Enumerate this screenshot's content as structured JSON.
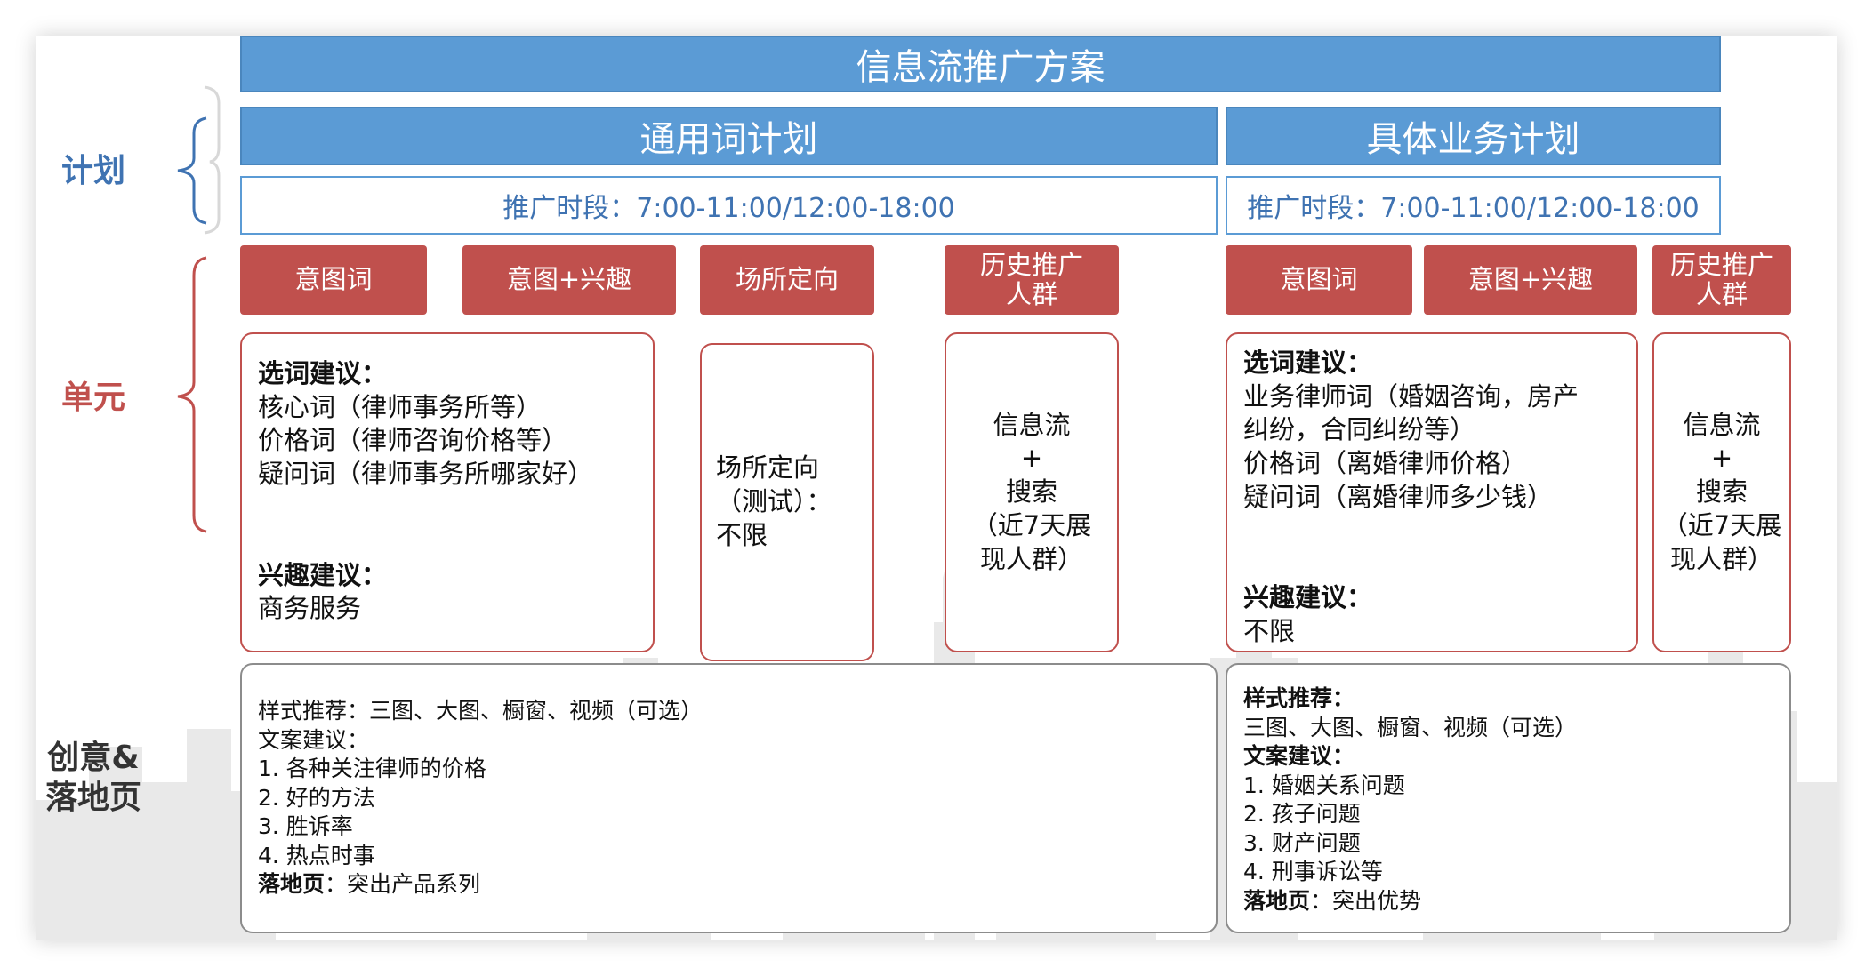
{
  "title": "信息流推广方案",
  "colors": {
    "blue": "#5b9bd5",
    "red": "#c0504d",
    "gray_border": "#8c8c8c"
  },
  "side_labels": {
    "plan": "计划",
    "unit": "单元",
    "creative_line1": "创意&",
    "creative_line2": "落地页"
  },
  "plans": [
    {
      "name": "通用词计划",
      "period": "推广时段：7:00-11:00/12:00-18:00",
      "units": [
        {
          "name": "意图词"
        },
        {
          "name": "意图+兴趣"
        },
        {
          "name": "场所定向"
        },
        {
          "name_line1": "历史推广",
          "name_line2": "人群"
        }
      ],
      "keyword_box": {
        "heading": "选词建议：",
        "lines": [
          "核心词（律师事务所等）",
          "价格词（律师咨询价格等）",
          "疑问词（律师事务所哪家好）"
        ],
        "interest_heading": "兴趣建议：",
        "interest_value": "商务服务"
      },
      "place_box": {
        "line1": "场所定向",
        "line2": "（测试）：",
        "line3": "不限"
      },
      "history_box": {
        "line1": "信息流",
        "line2": "+",
        "line3": "搜索",
        "line4": "（近7天展",
        "line5": "现人群）"
      },
      "creative": {
        "style": "样式推荐：三图、大图、橱窗、视频（可选）",
        "copy_heading": "文案建议：",
        "items": [
          "1.  各种关注律师的价格",
          "2.  好的方法",
          "3.  胜诉率",
          "4.  热点时事"
        ],
        "landing_label": "落地页",
        "landing_value": "：突出产品系列"
      }
    },
    {
      "name": "具体业务计划",
      "period": "推广时段：7:00-11:00/12:00-18:00",
      "units": [
        {
          "name": "意图词"
        },
        {
          "name": "意图+兴趣"
        },
        {
          "name_line1": "历史推广",
          "name_line2": "人群"
        }
      ],
      "keyword_box": {
        "heading": "选词建议：",
        "lines": [
          "业务律师词（婚姻咨询，房产",
          "纠纷，合同纠纷等）",
          "价格词（离婚律师价格）",
          "疑问词（离婚律师多少钱）"
        ],
        "interest_heading": "兴趣建议：",
        "interest_value": "不限"
      },
      "history_box": {
        "line1": "信息流",
        "line2": "+",
        "line3": "搜索",
        "line4": "（近7天展",
        "line5": "现人群）"
      },
      "creative": {
        "style_heading": "样式推荐：",
        "style_value": "三图、大图、橱窗、视频（可选）",
        "copy_heading": "文案建议：",
        "items": [
          "1.  婚姻关系问题",
          "2.  孩子问题",
          "3.  财产问题",
          "4.  刑事诉讼等"
        ],
        "landing_label": "落地页",
        "landing_value": "：突出优势"
      }
    }
  ]
}
